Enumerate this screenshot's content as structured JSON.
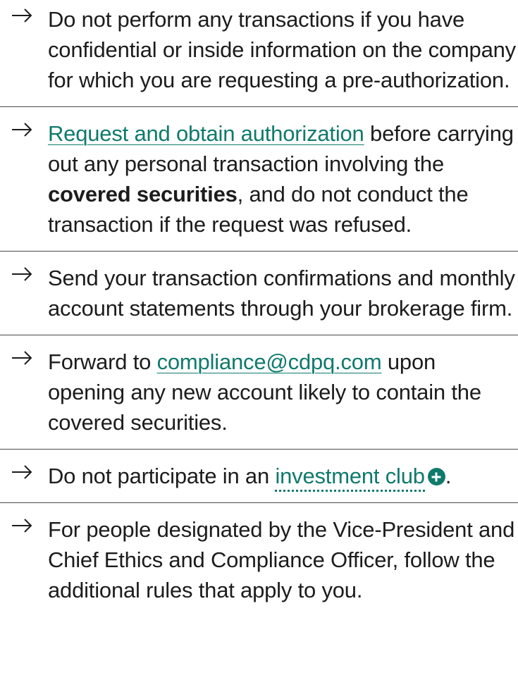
{
  "items": [
    {
      "text": "Do not perform any transactions if you have confidential or inside information on the company for which you are requesting a pre-authorization."
    },
    {
      "link": "Request and obtain authorization",
      "text_a": " before carrying out any personal transaction involving the ",
      "bold": "covered securities",
      "text_b": ", and do not conduct the transaction if the request was refused."
    },
    {
      "text": "Send your transaction confirmations and monthly account statements through your brokerage firm."
    },
    {
      "text_a": "Forward to ",
      "link": "compliance@cdpq.com",
      "text_b": " upon opening any new account likely to contain the covered securities."
    },
    {
      "text_a": "Do not participate in an ",
      "link": "investment club",
      "icon": "plus-circle-icon",
      "text_b": "."
    },
    {
      "text": "For people designated by the Vice-President and Chief Ethics and Compliance Officer, follow the additional rules that apply to you."
    }
  ],
  "colors": {
    "link": "#0f7a6c",
    "text": "#1c1c1c",
    "divider": "#4a4a4a"
  }
}
